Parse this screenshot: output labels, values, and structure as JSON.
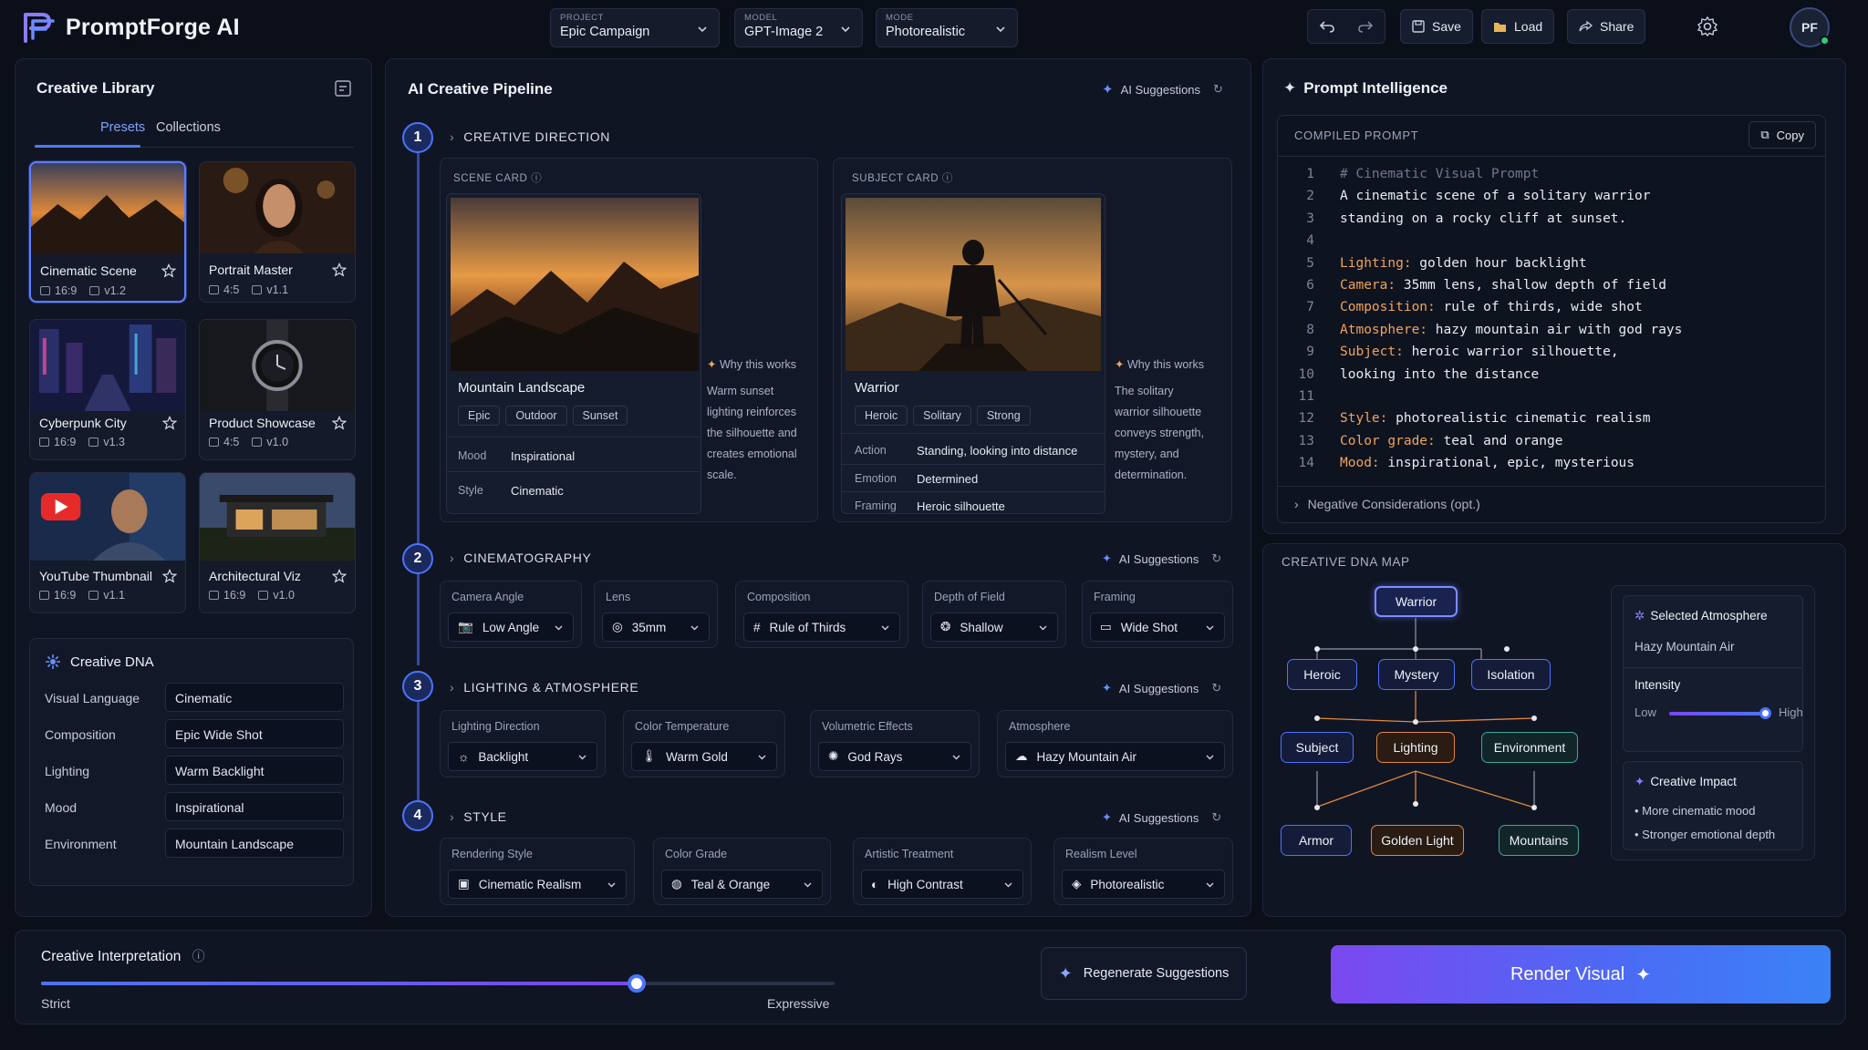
{
  "app": {
    "title": "PromptForge AI"
  },
  "top": {
    "project": {
      "label": "PROJECT",
      "value": "Epic Campaign"
    },
    "model": {
      "label": "MODEL",
      "value": "GPT-Image 2"
    },
    "mode": {
      "label": "MODE",
      "value": "Photorealistic"
    },
    "save": "Save",
    "load": "Load",
    "share": "Share",
    "avatar": "PF"
  },
  "library": {
    "title": "Creative Library",
    "tabs": [
      "Presets",
      "Collections"
    ],
    "cards": [
      {
        "name": "Cinematic Scene",
        "ratio": "16:9",
        "version": "v1.2"
      },
      {
        "name": "Portrait Master",
        "ratio": "4:5",
        "version": "v1.1"
      },
      {
        "name": "Cyberpunk City",
        "ratio": "16:9",
        "version": "v1.3"
      },
      {
        "name": "Product Showcase",
        "ratio": "4:5",
        "version": "v1.0"
      },
      {
        "name": "YouTube Thumbnail",
        "ratio": "16:9",
        "version": "v1.1"
      },
      {
        "name": "Architectural Viz",
        "ratio": "16:9",
        "version": "v1.0"
      }
    ],
    "dna": {
      "title": "Creative DNA",
      "rows": [
        {
          "label": "Visual Language",
          "value": "Cinematic"
        },
        {
          "label": "Composition",
          "value": "Epic Wide Shot"
        },
        {
          "label": "Lighting",
          "value": "Warm Backlight"
        },
        {
          "label": "Mood",
          "value": "Inspirational"
        },
        {
          "label": "Environment",
          "value": "Mountain Landscape"
        }
      ]
    }
  },
  "pipeline": {
    "title": "AI Creative Pipeline",
    "ai_suggestions": "AI Suggestions",
    "steps": [
      {
        "num": "1",
        "title": "CREATIVE DIRECTION"
      },
      {
        "num": "2",
        "title": "CINEMATOGRAPHY"
      },
      {
        "num": "3",
        "title": "LIGHTING & ATMOSPHERE"
      },
      {
        "num": "4",
        "title": "STYLE"
      }
    ],
    "scene": {
      "label": "SCENE CARD",
      "name": "Mountain Landscape",
      "chips": [
        "Epic",
        "Outdoor",
        "Sunset"
      ],
      "kv": [
        {
          "k": "Mood",
          "v": "Inspirational"
        },
        {
          "k": "Style",
          "v": "Cinematic"
        }
      ],
      "why_title": "Why this works",
      "why_lines": [
        "Warm sunset",
        "lighting reinforces",
        "the silhouette and",
        "creates emotional",
        "scale."
      ]
    },
    "subject": {
      "label": "SUBJECT CARD",
      "name": "Warrior",
      "chips": [
        "Heroic",
        "Solitary",
        "Strong"
      ],
      "kv": [
        {
          "k": "Action",
          "v": "Standing, looking into distance"
        },
        {
          "k": "Emotion",
          "v": "Determined"
        },
        {
          "k": "Framing",
          "v": "Heroic silhouette"
        }
      ],
      "why_title": "Why this works",
      "why_lines": [
        "The solitary",
        "warrior silhouette",
        "conveys strength,",
        "mystery, and",
        "determination."
      ]
    },
    "cinematography": [
      {
        "label": "Camera Angle",
        "value": "Low Angle"
      },
      {
        "label": "Lens",
        "value": "35mm"
      },
      {
        "label": "Composition",
        "value": "Rule of Thirds"
      },
      {
        "label": "Depth of Field",
        "value": "Shallow"
      },
      {
        "label": "Framing",
        "value": "Wide Shot"
      }
    ],
    "lighting": [
      {
        "label": "Lighting Direction",
        "value": "Backlight"
      },
      {
        "label": "Color Temperature",
        "value": "Warm Gold"
      },
      {
        "label": "Volumetric Effects",
        "value": "God Rays"
      },
      {
        "label": "Atmosphere",
        "value": "Hazy Mountain Air"
      }
    ],
    "style": [
      {
        "label": "Rendering Style",
        "value": "Cinematic Realism"
      },
      {
        "label": "Color Grade",
        "value": "Teal & Orange"
      },
      {
        "label": "Artistic Treatment",
        "value": "High Contrast"
      },
      {
        "label": "Realism Level",
        "value": "Photorealistic"
      }
    ]
  },
  "intel": {
    "title": "Prompt Intelligence",
    "compiled_label": "COMPILED PROMPT",
    "copy": "Copy",
    "lines": [
      {
        "n": "1",
        "key": "",
        "text": "# Cinematic Visual Prompt",
        "comment": true
      },
      {
        "n": "2",
        "key": "",
        "text": "A cinematic scene of a solitary warrior"
      },
      {
        "n": "3",
        "key": "",
        "text": "standing on a rocky cliff at sunset."
      },
      {
        "n": "4",
        "key": "",
        "text": ""
      },
      {
        "n": "5",
        "key": "Lighting:",
        "text": " golden hour backlight"
      },
      {
        "n": "6",
        "key": "Camera:",
        "text": " 35mm lens, shallow depth of field"
      },
      {
        "n": "7",
        "key": "Composition:",
        "text": " rule of thirds, wide shot"
      },
      {
        "n": "8",
        "key": "Atmosphere:",
        "text": " hazy mountain air with god rays"
      },
      {
        "n": "9",
        "key": "Subject:",
        "text": " heroic warrior silhouette,"
      },
      {
        "n": "10",
        "key": "",
        "text": "looking into the distance"
      },
      {
        "n": "11",
        "key": "",
        "text": ""
      },
      {
        "n": "12",
        "key": "Style:",
        "text": " photorealistic cinematic realism"
      },
      {
        "n": "13",
        "key": "Color grade:",
        "text": " teal and orange"
      },
      {
        "n": "14",
        "key": "Mood:",
        "text": " inspirational, epic, mysterious"
      }
    ],
    "negative": "Negative Considerations (opt.)",
    "dna_map": {
      "title": "CREATIVE DNA MAP",
      "nodes": {
        "root": "Warrior",
        "heroic": "Heroic",
        "mystery": "Mystery",
        "isolation": "Isolation",
        "subject": "Subject",
        "lighting": "Lighting",
        "environment": "Environment",
        "armor": "Armor",
        "golden": "Golden Light",
        "mountains": "Mountains"
      }
    },
    "atmosphere": {
      "title": "Selected Atmosphere",
      "value": "Hazy Mountain Air",
      "intensity_label": "Intensity",
      "low": "Low",
      "high": "High",
      "intensity": 0.95
    },
    "impact": {
      "title": "Creative Impact",
      "items": [
        "More cinematic mood",
        "Stronger emotional depth"
      ]
    }
  },
  "bottom": {
    "interp_title": "Creative Interpretation",
    "strict": "Strict",
    "expressive": "Expressive",
    "interp_value": 0.75,
    "regen": "Regenerate Suggestions",
    "render": "Render Visual"
  },
  "colors": {
    "accent": "#4c73ff",
    "orange": "#f0a35a",
    "render_start": "#7b48f0",
    "render_end": "#3b82f6"
  }
}
